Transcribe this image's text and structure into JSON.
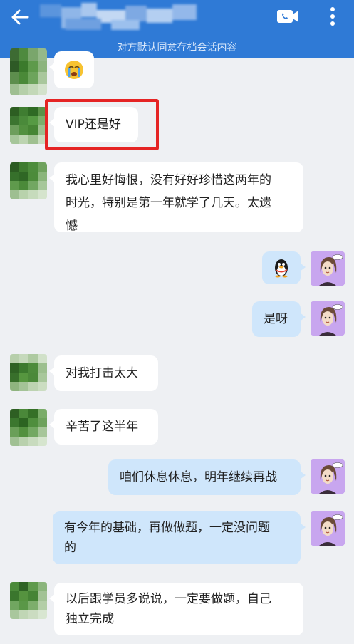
{
  "header": {
    "title": "",
    "back_icon": "back-arrow-icon",
    "call_icon": "video-call-icon",
    "more_icon": "more-vertical-icon",
    "background": "#2f7ad6"
  },
  "notice": {
    "text": "对方默认同意存档会话内容"
  },
  "messages": [
    {
      "side": "in",
      "type": "emoji",
      "emoji": "😭"
    },
    {
      "side": "in",
      "type": "text",
      "text": "VIP还是好"
    },
    {
      "side": "in",
      "type": "text",
      "lines": [
        "我心里好悔恨，没有好好珍惜这两年的",
        "时光，特别是第一年就学了几天。太遗",
        "憾"
      ]
    },
    {
      "side": "out",
      "type": "emoji",
      "emoji": "penguin-icon"
    },
    {
      "side": "out",
      "type": "text",
      "text": "是呀"
    },
    {
      "side": "in",
      "type": "text",
      "text": "对我打击太大"
    },
    {
      "side": "in",
      "type": "text",
      "text": "辛苦了这半年"
    },
    {
      "side": "out",
      "type": "text",
      "text": "咱们休息休息，明年继续再战"
    },
    {
      "side": "out",
      "type": "text",
      "lines": [
        "有今年的基础，再做做题，一定没问题",
        "的"
      ]
    },
    {
      "side": "in",
      "type": "text",
      "lines": [
        "以后跟学员多说说，一定要做题，自己",
        "独立完成"
      ]
    }
  ],
  "highlight_color": "#e52424"
}
